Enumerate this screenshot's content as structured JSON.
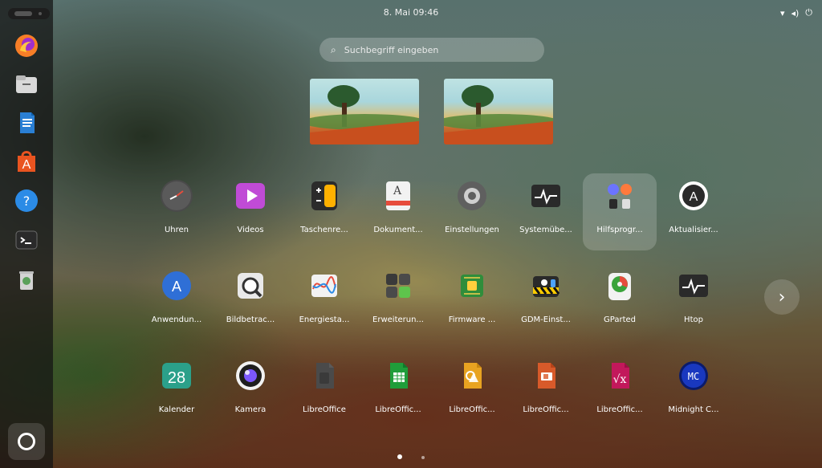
{
  "topbar": {
    "clock": "8. Mai  09:46",
    "tray": {
      "wifi_icon": "wifi-icon",
      "volume_icon": "volume-icon",
      "power_icon": "power-icon"
    }
  },
  "search": {
    "placeholder": "Suchbegriff eingeben",
    "icon": "search-icon"
  },
  "apps": [
    {
      "label": "Uhren",
      "icon": "clock-icon"
    },
    {
      "label": "Videos",
      "icon": "videos-icon"
    },
    {
      "label": "Taschenre...",
      "icon": "calculator-icon"
    },
    {
      "label": "Dokument...",
      "icon": "document-viewer-icon"
    },
    {
      "label": "Einstellungen",
      "icon": "settings-icon"
    },
    {
      "label": "Systemübe...",
      "icon": "system-monitor-icon"
    },
    {
      "label": "Hilfsprogr...",
      "icon": "utilities-folder-icon",
      "selected": true
    },
    {
      "label": "Aktualisier...",
      "icon": "software-updater-icon"
    },
    {
      "label": "Anwendun...",
      "icon": "app-center-icon"
    },
    {
      "label": "Bildbetrac...",
      "icon": "image-viewer-icon"
    },
    {
      "label": "Energiesta...",
      "icon": "power-statistics-icon"
    },
    {
      "label": "Erweiterun...",
      "icon": "extensions-icon"
    },
    {
      "label": "Firmware ...",
      "icon": "firmware-icon"
    },
    {
      "label": "GDM-Einst...",
      "icon": "gdm-settings-icon"
    },
    {
      "label": "GParted",
      "icon": "gparted-icon"
    },
    {
      "label": "Htop",
      "icon": "htop-icon"
    },
    {
      "label": "Kalender",
      "icon": "calendar-icon",
      "calendar_day": "28"
    },
    {
      "label": "Kamera",
      "icon": "camera-icon"
    },
    {
      "label": "LibreOffice",
      "icon": "libreoffice-icon"
    },
    {
      "label": "LibreOffic...",
      "icon": "libreoffice-calc-icon"
    },
    {
      "label": "LibreOffic...",
      "icon": "libreoffice-draw-icon"
    },
    {
      "label": "LibreOffic...",
      "icon": "libreoffice-impress-icon"
    },
    {
      "label": "LibreOffic...",
      "icon": "libreoffice-math-icon"
    },
    {
      "label": "Midnight C...",
      "icon": "midnight-commander-icon",
      "icon_text": "MC"
    }
  ],
  "dock": {
    "items": [
      {
        "icon": "firefox-icon"
      },
      {
        "icon": "files-icon"
      },
      {
        "icon": "libreoffice-writer-icon"
      },
      {
        "icon": "app-center-icon"
      },
      {
        "icon": "help-icon"
      },
      {
        "icon": "terminal-icon"
      },
      {
        "icon": "trash-icon"
      }
    ],
    "show_apps_icon": "ubuntu-logo-icon"
  },
  "pager": {
    "pages": 2,
    "active_index": 0
  }
}
